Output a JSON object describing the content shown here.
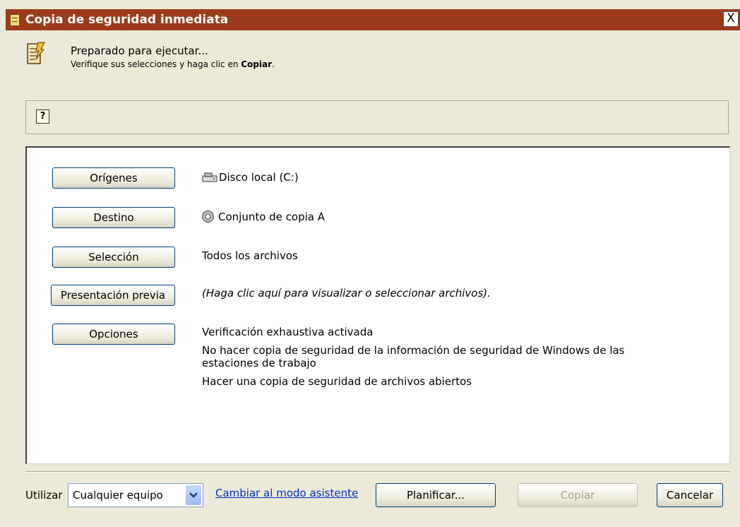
{
  "window": {
    "title": "Copia de seguridad inmediata",
    "close_label": "X"
  },
  "header": {
    "title": "Preparado para ejecutar...",
    "subtitle_prefix": "Verifique sus selecciones y haga clic en ",
    "subtitle_bold": "Copiar",
    "subtitle_suffix": "."
  },
  "helpbar": {
    "icon_label": "?"
  },
  "rows": [
    {
      "button_label": "Orígenes",
      "values": [
        "Disco local (C:)"
      ],
      "icon": "hard-drive-icon"
    },
    {
      "button_label": "Destino",
      "values": [
        "Conjunto de copia A"
      ],
      "icon": "backup-disc-icon"
    },
    {
      "button_label": "Selección",
      "values": [
        "Todos los archivos"
      ]
    },
    {
      "button_label": "Presentación previa",
      "values": [
        "(Haga clic aquí para visualizar o seleccionar archivos)."
      ]
    },
    {
      "button_label": "Opciones",
      "values": [
        "Verificación exhaustiva activada",
        "No hacer copia de seguridad de la información de seguridad de Windows de las",
        "estaciones de trabajo",
        "Hacer una copia de seguridad de archivos abiertos"
      ]
    }
  ],
  "footer": {
    "utilizar_label": "Utilizar",
    "computer_select_value": "Cualquier equipo",
    "wizard_link": "Cambiar al modo asistente",
    "schedule_button": "Planificar...",
    "copy_button": "Copiar",
    "cancel_button": "Cancelar"
  }
}
